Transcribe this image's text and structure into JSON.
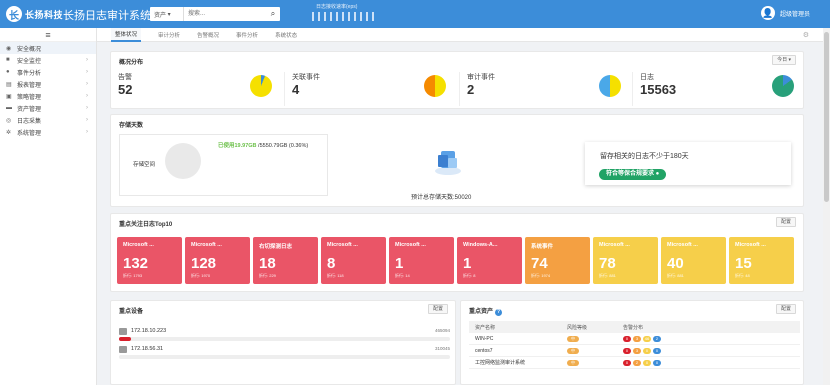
{
  "topbar": {
    "logo_badge": "长",
    "logo_text": "长扬科技",
    "app_title": "长扬日志审计系统",
    "search_select": "资产",
    "search_placeholder": "搜索...",
    "rate_label": "日志接收速率(eps)",
    "user_name": "超级管理员"
  },
  "sidebar": {
    "items": [
      {
        "icon": "dashboard-icon",
        "glyph": "◉",
        "label": "安全概况",
        "active": true
      },
      {
        "icon": "monitor-icon",
        "glyph": "■",
        "label": "安全监控"
      },
      {
        "icon": "info-icon",
        "glyph": "●",
        "label": "事件分析"
      },
      {
        "icon": "report-icon",
        "glyph": "▤",
        "label": "报表管理"
      },
      {
        "icon": "policy-icon",
        "glyph": "▣",
        "label": "策略管理"
      },
      {
        "icon": "asset-icon",
        "glyph": "▬",
        "label": "资产管理"
      },
      {
        "icon": "collect-icon",
        "glyph": "◎",
        "label": "日志采集"
      },
      {
        "icon": "settings-icon",
        "glyph": "✲",
        "label": "系统管理"
      }
    ]
  },
  "tabs": [
    "整体状况",
    "审计分析",
    "告警概况",
    "事件分析",
    "系统状态"
  ],
  "overview": {
    "title": "概况分布",
    "range_button": "今日 ▾",
    "stats": [
      {
        "label": "告警",
        "value": "52",
        "pie_a": "#f5e000",
        "pie_b": "#3c8dd9",
        "frac": 0.06
      },
      {
        "label": "关联事件",
        "value": "4",
        "pie_a": "#f58a00",
        "pie_b": "#f5e000",
        "frac": 0.5
      },
      {
        "label": "审计事件",
        "value": "2",
        "pie_a": "#4aa8e8",
        "pie_b": "#f5e000",
        "frac": 0.5
      },
      {
        "label": "日志",
        "value": "15563",
        "pie_a": "#28a07a",
        "pie_b": "#3c8dd9",
        "frac": 0.15
      }
    ]
  },
  "storage": {
    "title": "存储天数",
    "space_label": "存储空间",
    "used_value": "已使用19.97GB",
    "total_text": " /5550.79GB (0.36%)",
    "estimate": "预计总存储天数:50020",
    "tip_text": "留存相关的日志不少于180天",
    "tip_badge": "符合等保合规要求 ●"
  },
  "top10": {
    "title": "重点关注日志Top10",
    "config_button": "配置",
    "cards": [
      {
        "title": "Microsoft ...",
        "value": "132",
        "sub": "折行: 1793",
        "color": "#ea5567"
      },
      {
        "title": "Microsoft ...",
        "value": "128",
        "sub": "折行: 1970",
        "color": "#ea5567"
      },
      {
        "title": "右切探测日志",
        "value": "18",
        "sub": "折行: 229",
        "color": "#ea5567"
      },
      {
        "title": "Microsoft ...",
        "value": "8",
        "sub": "折行: 118",
        "color": "#ea5567"
      },
      {
        "title": "Microsoft ...",
        "value": "1",
        "sub": "折行: 14",
        "color": "#ea5567"
      },
      {
        "title": "Windows-A...",
        "value": "1",
        "sub": "折行: 8",
        "color": "#ea5567"
      },
      {
        "title": "系统事件",
        "value": "74",
        "sub": "折行: 1974",
        "color": "#f4a042"
      },
      {
        "title": "Microsoft ...",
        "value": "78",
        "sub": "折行: 881",
        "color": "#f6cf4a"
      },
      {
        "title": "Microsoft ...",
        "value": "40",
        "sub": "折行: 881",
        "color": "#f6cf4a"
      },
      {
        "title": "Microsoft ...",
        "value": "15",
        "sub": "折行: 48",
        "color": "#f6cf4a"
      }
    ]
  },
  "devices": {
    "title": "重点设备",
    "config_button": "配置",
    "rows": [
      {
        "name": "172.18.10.223",
        "count": "465094",
        "fill": 0.035
      },
      {
        "name": "172.18.56.31",
        "count": "310045",
        "fill": 0
      }
    ]
  },
  "assets": {
    "title": "重点资产",
    "help": "?",
    "config_button": "配置",
    "headers": [
      "资产名称",
      "风险等级",
      "告警分布"
    ],
    "rows": [
      {
        "name": "WIN-PC",
        "risk": "中",
        "dots": [
          {
            "v": "0",
            "c": "#d9202c"
          },
          {
            "v": "3",
            "c": "#f4a042"
          },
          {
            "v": "46",
            "c": "#f6cf4a"
          },
          {
            "v": "2",
            "c": "#3c8dd9"
          }
        ]
      },
      {
        "name": "centos7",
        "risk": "中",
        "dots": [
          {
            "v": "0",
            "c": "#d9202c"
          },
          {
            "v": "3",
            "c": "#f4a042"
          },
          {
            "v": "0",
            "c": "#f6cf4a"
          },
          {
            "v": "0",
            "c": "#3c8dd9"
          }
        ]
      },
      {
        "name": "工控网络监测审计系统",
        "risk": "中",
        "dots": [
          {
            "v": "0",
            "c": "#d9202c"
          },
          {
            "v": "2",
            "c": "#f4a042"
          },
          {
            "v": "0",
            "c": "#f6cf4a"
          },
          {
            "v": "0",
            "c": "#3c8dd9"
          }
        ]
      }
    ]
  }
}
